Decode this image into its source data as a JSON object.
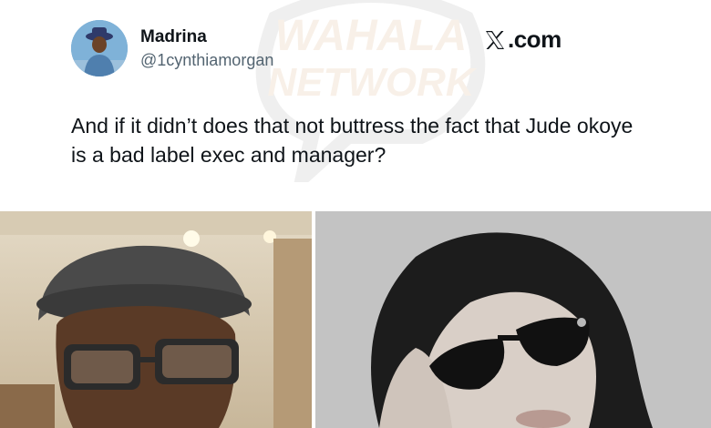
{
  "tweet": {
    "author_name": "Madrina",
    "author_handle": "@1cynthiamorgan",
    "text": "And if it didn’t does that not buttress the fact that Jude okoye is a bad label exec and manager?",
    "platform_label": ".com"
  },
  "watermark": {
    "line1": "WAHALA",
    "line2": "NETWORK"
  },
  "media": {
    "left_photo_icon": "man-in-cap-photo",
    "right_photo_icon": "woman-in-sunglasses-photo"
  },
  "colors": {
    "text_primary": "#0f1419",
    "text_secondary": "#536471",
    "background": "#ffffff"
  }
}
